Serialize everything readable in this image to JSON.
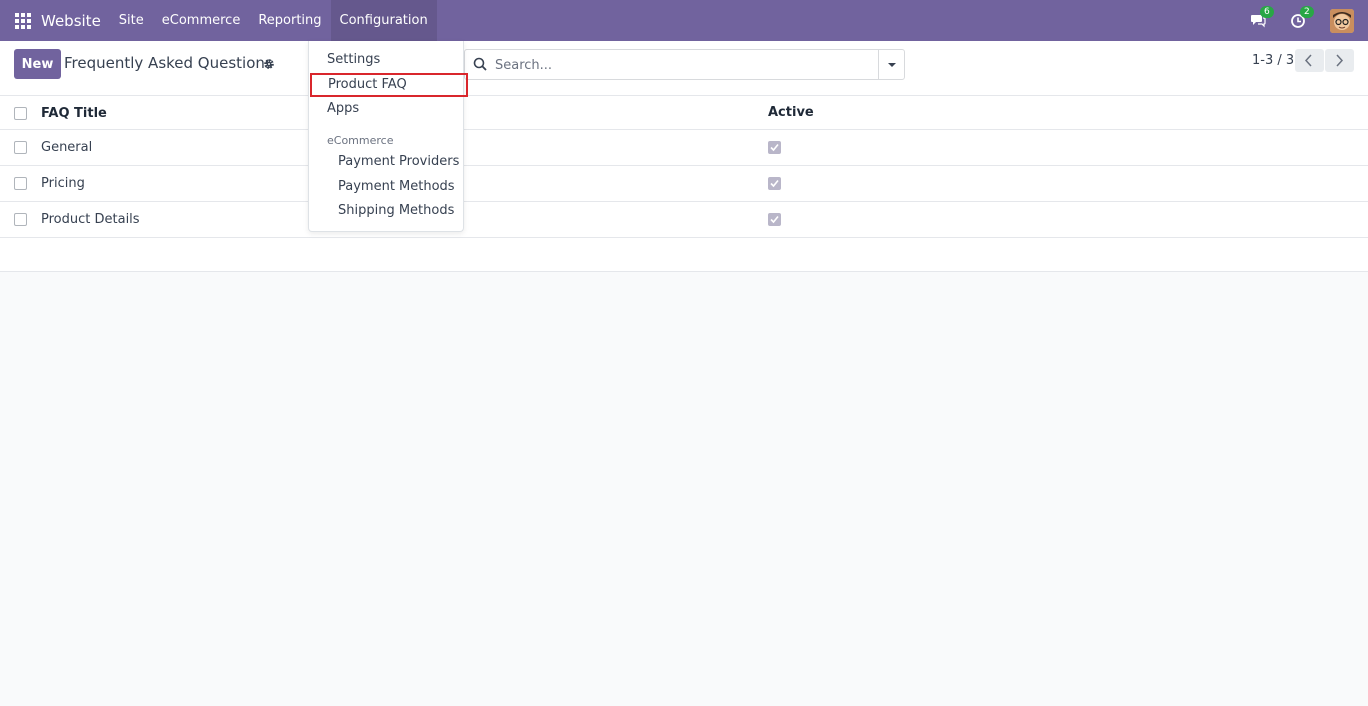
{
  "navbar": {
    "brand": "Website",
    "menu": [
      {
        "label": "Site"
      },
      {
        "label": "eCommerce"
      },
      {
        "label": "Reporting"
      },
      {
        "label": "Configuration"
      }
    ],
    "messages_count": "6",
    "activities_count": "2",
    "color": "#71639e"
  },
  "control_panel": {
    "new_label": "New",
    "title": "Frequently Asked Questions",
    "search_placeholder": "Search...",
    "pager": "1-3 / 3"
  },
  "list": {
    "columns": {
      "title": "FAQ Title",
      "active": "Active"
    },
    "rows": [
      {
        "title": "General",
        "active": true
      },
      {
        "title": "Pricing",
        "active": true
      },
      {
        "title": "Product Details",
        "active": true
      }
    ]
  },
  "dropdown": {
    "items": [
      {
        "label": "Settings"
      },
      {
        "label": "Product FAQ"
      },
      {
        "label": "Apps"
      }
    ],
    "section_header": "eCommerce",
    "section_items": [
      {
        "label": "Payment Providers"
      },
      {
        "label": "Payment Methods"
      },
      {
        "label": "Shipping Methods"
      }
    ],
    "highlight_color": "#d9262c"
  }
}
